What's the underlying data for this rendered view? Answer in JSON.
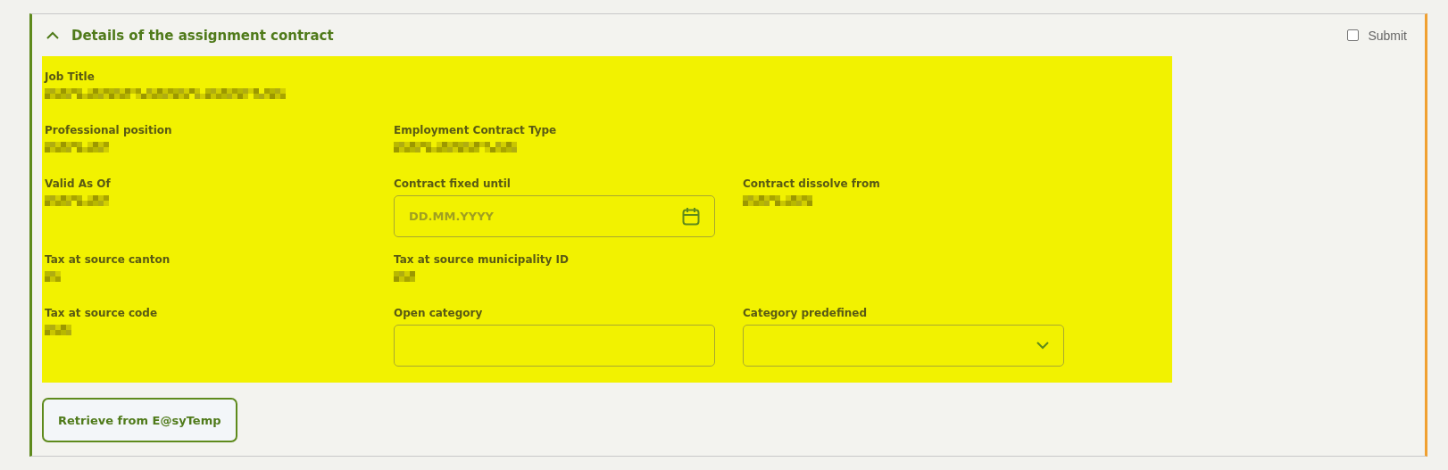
{
  "section": {
    "title": "Details of the assignment contract",
    "expanded": true,
    "submit": {
      "label": "Submit",
      "checked": false
    },
    "rows": [
      [
        {
          "label": "Job Title",
          "kind": "value",
          "redacted": true
        }
      ],
      [
        {
          "label": "Professional position",
          "kind": "value",
          "redacted": true
        },
        {
          "label": "Employment Contract Type",
          "kind": "value",
          "redacted": true
        }
      ],
      [
        {
          "label": "Valid As Of",
          "kind": "value",
          "redacted": true
        },
        {
          "label": "Contract fixed until",
          "kind": "date",
          "placeholder": "DD.MM.YYYY"
        },
        {
          "label": "Contract dissolve from",
          "kind": "value",
          "redacted": true
        }
      ],
      [
        {
          "label": "Tax at source canton",
          "kind": "value",
          "redacted": true
        },
        {
          "label": "Tax at source municipality ID",
          "kind": "value",
          "redacted": true
        }
      ],
      [
        {
          "label": "Tax at source code",
          "kind": "value",
          "redacted": true
        },
        {
          "label": "Open category",
          "kind": "text"
        },
        {
          "label": "Category predefined",
          "kind": "select"
        }
      ]
    ],
    "button": "Retrieve from E@syTemp"
  }
}
